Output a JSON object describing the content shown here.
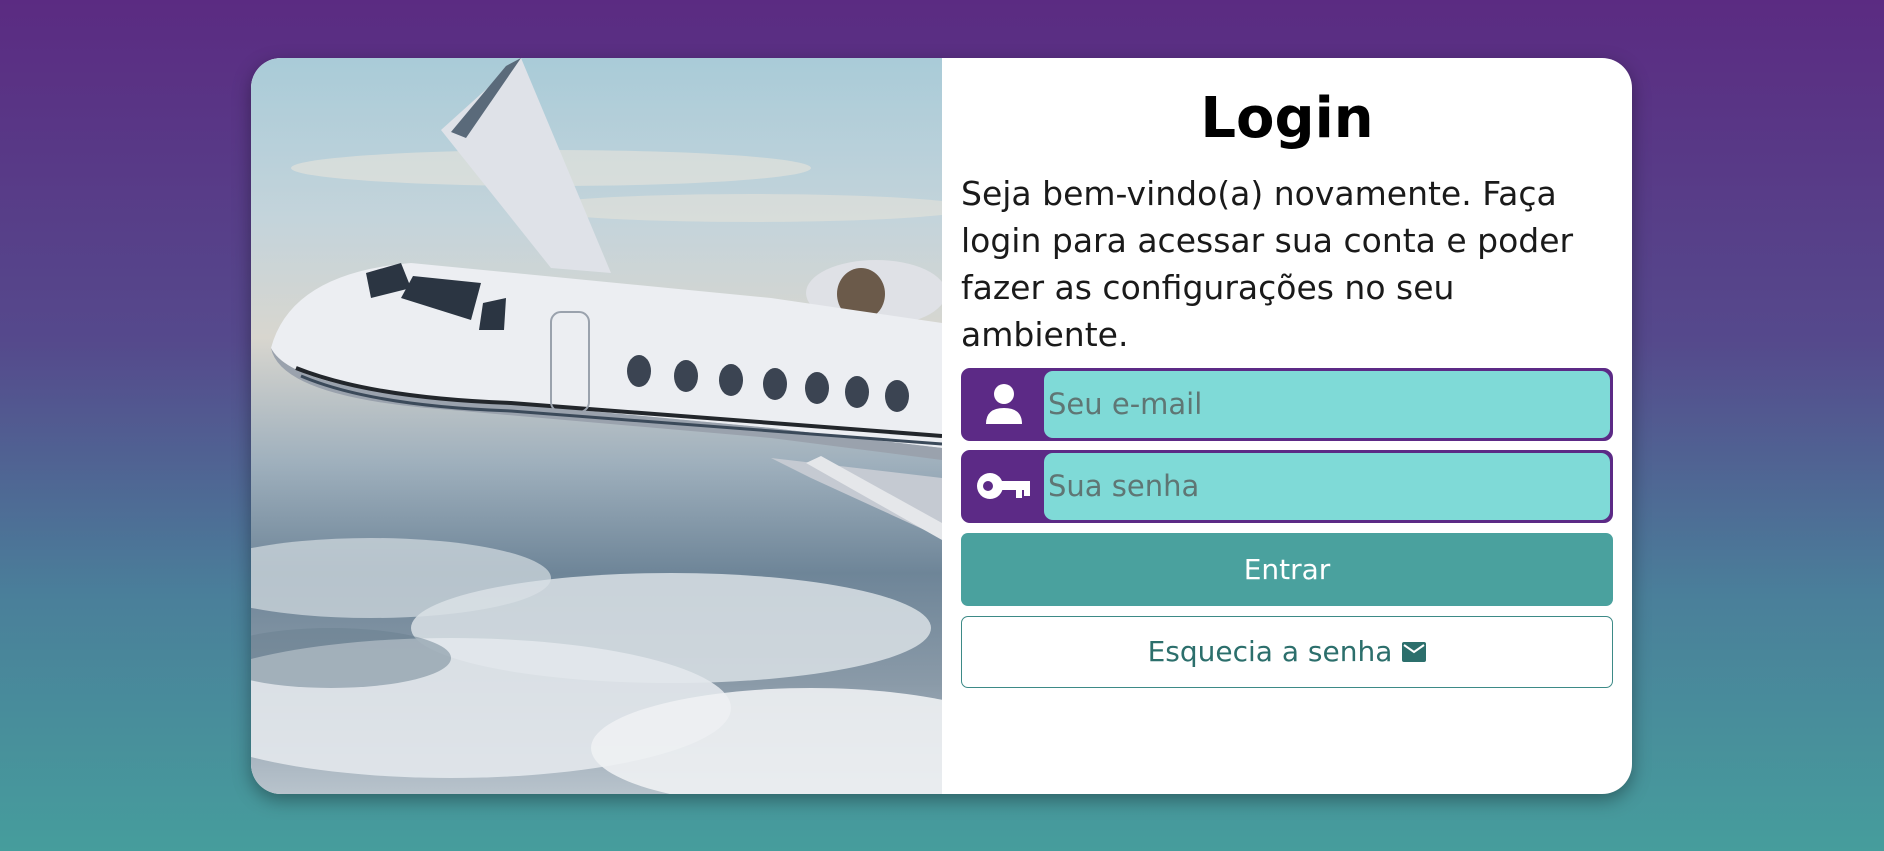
{
  "login": {
    "title": "Login",
    "subtitle": "Seja bem-vindo(a) novamente. Faça login para acessar sua conta e poder fazer as configurações no seu ambiente.",
    "email": {
      "placeholder": "Seu e-mail",
      "icon": "user-icon"
    },
    "password": {
      "placeholder": "Sua senha",
      "icon": "key-icon"
    },
    "submit_label": "Entrar",
    "forgot_label": "Esquecia a senha",
    "forgot_icon": "mail-icon"
  },
  "colors": {
    "accent_purple": "#5c2a86",
    "input_bg": "#7fdad7",
    "button_teal": "#4aa19e",
    "outline_teal": "#2c6f6c"
  }
}
